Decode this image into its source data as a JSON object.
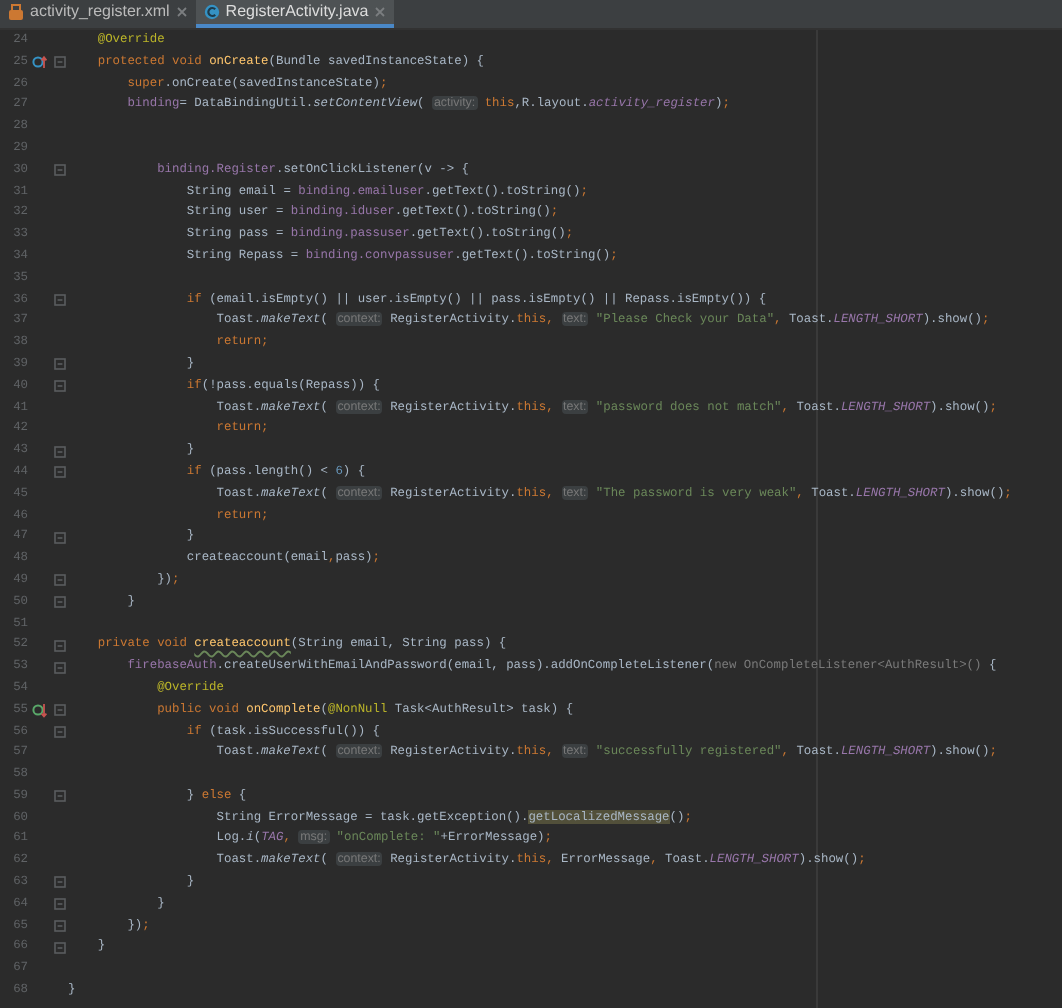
{
  "tabs": [
    {
      "label": "activity_register.xml",
      "kind": "xml",
      "selected": false
    },
    {
      "label": "RegisterActivity.java",
      "kind": "java",
      "selected": true
    }
  ],
  "lines": [
    {
      "number": "24",
      "fold": false,
      "kind": "plain",
      "segments": [
        {
          "text": "    @Override",
          "kind": "annotation"
        }
      ]
    },
    {
      "number": "25",
      "fold": true,
      "kind": "override",
      "segments": [
        {
          "text": "    protected void ",
          "kind": "keyword"
        },
        {
          "text": "onCreate",
          "kind": "declaration"
        },
        {
          "text": "(Bundle savedInstanceState) {",
          "kind": "plain"
        }
      ]
    },
    {
      "number": "26",
      "fold": false,
      "kind": "plain",
      "segments": [
        {
          "text": "        super",
          "kind": "keyword"
        },
        {
          "text": ".onCreate(savedInstanceState)",
          "kind": "plain"
        },
        {
          "text": ";",
          "kind": "keyword"
        }
      ]
    },
    {
      "number": "27",
      "fold": false,
      "kind": "plain",
      "segments": [
        {
          "text": "        binding",
          "kind": "field"
        },
        {
          "text": "= DataBindingUtil.",
          "kind": "plain"
        },
        {
          "text": "setContentView",
          "kind": "static-method"
        },
        {
          "text": "( ",
          "kind": "plain"
        },
        {
          "text": "activity:",
          "kind": "hint"
        },
        {
          "text": " this",
          "kind": "keyword"
        },
        {
          "text": ",R.layout.",
          "kind": "plain"
        },
        {
          "text": "activity_register",
          "kind": "constant"
        },
        {
          "text": ")",
          "kind": "plain"
        },
        {
          "text": ";",
          "kind": "keyword"
        }
      ]
    },
    {
      "number": "28",
      "fold": false,
      "kind": "plain"
    },
    {
      "number": "29",
      "fold": false,
      "kind": "plain"
    },
    {
      "number": "30",
      "fold": true,
      "kind": "plain",
      "segments": [
        {
          "text": "            binding.Register",
          "kind": "field"
        },
        {
          "text": ".setOnClickListener(v -> {",
          "kind": "plain"
        }
      ]
    },
    {
      "number": "31",
      "fold": false,
      "kind": "plain",
      "segments": [
        {
          "text": "                String email = ",
          "kind": "plain"
        },
        {
          "text": "binding.emailuser",
          "kind": "field"
        },
        {
          "text": ".getText().toString()",
          "kind": "plain"
        },
        {
          "text": ";",
          "kind": "keyword"
        }
      ]
    },
    {
      "number": "32",
      "fold": false,
      "kind": "plain",
      "segments": [
        {
          "text": "                String user = ",
          "kind": "plain"
        },
        {
          "text": "binding.iduser",
          "kind": "field"
        },
        {
          "text": ".getText().toString()",
          "kind": "plain"
        },
        {
          "text": ";",
          "kind": "keyword"
        }
      ]
    },
    {
      "number": "33",
      "fold": false,
      "kind": "plain",
      "segments": [
        {
          "text": "                String pass = ",
          "kind": "plain"
        },
        {
          "text": "binding.passuser",
          "kind": "field"
        },
        {
          "text": ".getText().toString()",
          "kind": "plain"
        },
        {
          "text": ";",
          "kind": "keyword"
        }
      ]
    },
    {
      "number": "34",
      "fold": false,
      "kind": "plain",
      "segments": [
        {
          "text": "                String Repass = ",
          "kind": "plain"
        },
        {
          "text": "binding.convpassuser",
          "kind": "field"
        },
        {
          "text": ".getText().toString()",
          "kind": "plain"
        },
        {
          "text": ";",
          "kind": "keyword"
        }
      ]
    },
    {
      "number": "35",
      "fold": false,
      "kind": "plain"
    },
    {
      "number": "36",
      "fold": true,
      "kind": "plain",
      "segments": [
        {
          "text": "                if",
          "kind": "keyword"
        },
        {
          "text": " (email.isEmpty() || user.isEmpty() || pass.isEmpty() || Repass.isEmpty()) {",
          "kind": "plain"
        }
      ]
    },
    {
      "number": "37",
      "fold": false,
      "kind": "plain",
      "segments": [
        {
          "text": "                    Toast.",
          "kind": "plain"
        },
        {
          "text": "makeText",
          "kind": "static-method"
        },
        {
          "text": "( ",
          "kind": "plain"
        },
        {
          "text": "context:",
          "kind": "hint"
        },
        {
          "text": " RegisterActivity.",
          "kind": "plain"
        },
        {
          "text": "this, ",
          "kind": "keyword"
        },
        {
          "text": "text:",
          "kind": "hint"
        },
        {
          "text": " \"Please Check your Data\"",
          "kind": "string"
        },
        {
          "text": ", ",
          "kind": "keyword"
        },
        {
          "text": "Toast.",
          "kind": "plain"
        },
        {
          "text": "LENGTH_SHORT",
          "kind": "constant"
        },
        {
          "text": ").show()",
          "kind": "plain"
        },
        {
          "text": ";",
          "kind": "keyword"
        }
      ]
    },
    {
      "number": "38",
      "fold": false,
      "kind": "plain",
      "segments": [
        {
          "text": "                    return;",
          "kind": "keyword"
        }
      ]
    },
    {
      "number": "39",
      "fold": true,
      "kind": "plain",
      "segments": [
        {
          "text": "                }",
          "kind": "plain"
        }
      ]
    },
    {
      "number": "40",
      "fold": true,
      "kind": "plain",
      "segments": [
        {
          "text": "                if",
          "kind": "keyword"
        },
        {
          "text": "(!pass.equals(Repass)) {",
          "kind": "plain"
        }
      ]
    },
    {
      "number": "41",
      "fold": false,
      "kind": "plain",
      "segments": [
        {
          "text": "                    Toast.",
          "kind": "plain"
        },
        {
          "text": "makeText",
          "kind": "static-method"
        },
        {
          "text": "( ",
          "kind": "plain"
        },
        {
          "text": "context:",
          "kind": "hint"
        },
        {
          "text": " RegisterActivity.",
          "kind": "plain"
        },
        {
          "text": "this, ",
          "kind": "keyword"
        },
        {
          "text": "text:",
          "kind": "hint"
        },
        {
          "text": " \"password does not match\"",
          "kind": "string"
        },
        {
          "text": ", ",
          "kind": "keyword"
        },
        {
          "text": "Toast.",
          "kind": "plain"
        },
        {
          "text": "LENGTH_SHORT",
          "kind": "constant"
        },
        {
          "text": ").show()",
          "kind": "plain"
        },
        {
          "text": ";",
          "kind": "keyword"
        }
      ]
    },
    {
      "number": "42",
      "fold": false,
      "kind": "plain",
      "segments": [
        {
          "text": "                    return;",
          "kind": "keyword"
        }
      ]
    },
    {
      "number": "43",
      "fold": true,
      "kind": "plain",
      "segments": [
        {
          "text": "                }",
          "kind": "plain"
        }
      ]
    },
    {
      "number": "44",
      "fold": true,
      "kind": "plain",
      "segments": [
        {
          "text": "                if",
          "kind": "keyword"
        },
        {
          "text": " (pass.length() < ",
          "kind": "plain"
        },
        {
          "text": "6",
          "kind": "number"
        },
        {
          "text": ") {",
          "kind": "plain"
        }
      ]
    },
    {
      "number": "45",
      "fold": false,
      "kind": "plain",
      "segments": [
        {
          "text": "                    Toast.",
          "kind": "plain"
        },
        {
          "text": "makeText",
          "kind": "static-method"
        },
        {
          "text": "( ",
          "kind": "plain"
        },
        {
          "text": "context:",
          "kind": "hint"
        },
        {
          "text": " RegisterActivity.",
          "kind": "plain"
        },
        {
          "text": "this, ",
          "kind": "keyword"
        },
        {
          "text": "text:",
          "kind": "hint"
        },
        {
          "text": " \"The password is very weak\"",
          "kind": "string"
        },
        {
          "text": ", ",
          "kind": "keyword"
        },
        {
          "text": "Toast.",
          "kind": "plain"
        },
        {
          "text": "LENGTH_SHORT",
          "kind": "constant"
        },
        {
          "text": ").show()",
          "kind": "plain"
        },
        {
          "text": ";",
          "kind": "keyword"
        }
      ]
    },
    {
      "number": "46",
      "fold": false,
      "kind": "plain",
      "segments": [
        {
          "text": "                    return;",
          "kind": "keyword"
        }
      ]
    },
    {
      "number": "47",
      "fold": true,
      "kind": "plain",
      "segments": [
        {
          "text": "                }",
          "kind": "plain"
        }
      ]
    },
    {
      "number": "48",
      "fold": false,
      "kind": "plain",
      "segments": [
        {
          "text": "                createaccount(email",
          "kind": "plain"
        },
        {
          "text": ",",
          "kind": "keyword"
        },
        {
          "text": "pass)",
          "kind": "plain"
        },
        {
          "text": ";",
          "kind": "keyword"
        }
      ]
    },
    {
      "number": "49",
      "fold": true,
      "kind": "plain",
      "segments": [
        {
          "text": "            })",
          "kind": "plain"
        },
        {
          "text": ";",
          "kind": "keyword"
        }
      ]
    },
    {
      "number": "50",
      "fold": true,
      "kind": "plain",
      "segments": [
        {
          "text": "        }",
          "kind": "plain"
        }
      ]
    },
    {
      "number": "51",
      "fold": false,
      "kind": "plain"
    },
    {
      "number": "52",
      "fold": true,
      "kind": "plain",
      "segments": [
        {
          "text": "    private void ",
          "kind": "keyword"
        },
        {
          "text": "createaccount",
          "kind": "declaration-unused"
        },
        {
          "text": "(String email, String pass) {",
          "kind": "plain"
        }
      ]
    },
    {
      "number": "53",
      "fold": true,
      "kind": "plain",
      "segments": [
        {
          "text": "        firebaseAuth",
          "kind": "field"
        },
        {
          "text": ".createUserWithEmailAndPassword(email, pass).addOnCompleteListener(",
          "kind": "plain"
        },
        {
          "text": "new OnCompleteListener<AuthResult>()",
          "kind": "folded"
        },
        {
          "text": " {",
          "kind": "plain"
        }
      ]
    },
    {
      "number": "54",
      "fold": false,
      "kind": "plain",
      "segments": [
        {
          "text": "            @Override",
          "kind": "annotation"
        }
      ]
    },
    {
      "number": "55",
      "fold": true,
      "kind": "implement",
      "segments": [
        {
          "text": "            public void ",
          "kind": "keyword"
        },
        {
          "text": "onComplete",
          "kind": "declaration"
        },
        {
          "text": "(",
          "kind": "plain"
        },
        {
          "text": "@NonNull",
          "kind": "annotation"
        },
        {
          "text": " Task<AuthResult> task) {",
          "kind": "plain"
        }
      ]
    },
    {
      "number": "56",
      "fold": true,
      "kind": "plain",
      "segments": [
        {
          "text": "                if",
          "kind": "keyword"
        },
        {
          "text": " (task.isSuccessful()) {",
          "kind": "plain"
        }
      ]
    },
    {
      "number": "57",
      "fold": false,
      "kind": "plain",
      "segments": [
        {
          "text": "                    Toast.",
          "kind": "plain"
        },
        {
          "text": "makeText",
          "kind": "static-method"
        },
        {
          "text": "( ",
          "kind": "plain"
        },
        {
          "text": "context:",
          "kind": "hint"
        },
        {
          "text": " RegisterActivity.",
          "kind": "plain"
        },
        {
          "text": "this, ",
          "kind": "keyword"
        },
        {
          "text": "text:",
          "kind": "hint"
        },
        {
          "text": " \"successfully registered\"",
          "kind": "string"
        },
        {
          "text": ", ",
          "kind": "keyword"
        },
        {
          "text": "Toast.",
          "kind": "plain"
        },
        {
          "text": "LENGTH_SHORT",
          "kind": "constant"
        },
        {
          "text": ").show()",
          "kind": "plain"
        },
        {
          "text": ";",
          "kind": "keyword"
        }
      ]
    },
    {
      "number": "58",
      "fold": false,
      "kind": "plain"
    },
    {
      "number": "59",
      "fold": true,
      "kind": "plain",
      "segments": [
        {
          "text": "                } ",
          "kind": "plain"
        },
        {
          "text": "else",
          "kind": "keyword"
        },
        {
          "text": " {",
          "kind": "plain"
        }
      ]
    },
    {
      "number": "60",
      "fold": false,
      "kind": "plain",
      "segments": [
        {
          "text": "                    String ErrorMessage = task.getException().",
          "kind": "plain"
        },
        {
          "text": "getLocalizedMessage",
          "kind": "highlight"
        },
        {
          "text": "()",
          "kind": "plain"
        },
        {
          "text": ";",
          "kind": "keyword"
        }
      ]
    },
    {
      "number": "61",
      "fold": false,
      "kind": "plain",
      "segments": [
        {
          "text": "                    Log.",
          "kind": "plain"
        },
        {
          "text": "i",
          "kind": "static-method"
        },
        {
          "text": "(",
          "kind": "plain"
        },
        {
          "text": "TAG",
          "kind": "constant"
        },
        {
          "text": ", ",
          "kind": "keyword"
        },
        {
          "text": "msg:",
          "kind": "hint"
        },
        {
          "text": " \"onComplete: \"",
          "kind": "string"
        },
        {
          "text": "+ErrorMessage)",
          "kind": "plain"
        },
        {
          "text": ";",
          "kind": "keyword"
        }
      ]
    },
    {
      "number": "62",
      "fold": false,
      "kind": "plain",
      "segments": [
        {
          "text": "                    Toast.",
          "kind": "plain"
        },
        {
          "text": "makeText",
          "kind": "static-method"
        },
        {
          "text": "( ",
          "kind": "plain"
        },
        {
          "text": "context:",
          "kind": "hint"
        },
        {
          "text": " RegisterActivity.",
          "kind": "plain"
        },
        {
          "text": "this",
          "kind": "keyword"
        },
        {
          "text": ", ",
          "kind": "keyword"
        },
        {
          "text": "ErrorMessage",
          "kind": "plain"
        },
        {
          "text": ", ",
          "kind": "keyword"
        },
        {
          "text": "Toast.",
          "kind": "plain"
        },
        {
          "text": "LENGTH_SHORT",
          "kind": "constant"
        },
        {
          "text": ").show()",
          "kind": "plain"
        },
        {
          "text": ";",
          "kind": "keyword"
        }
      ]
    },
    {
      "number": "63",
      "fold": true,
      "kind": "plain",
      "segments": [
        {
          "text": "                }",
          "kind": "plain"
        }
      ]
    },
    {
      "number": "64",
      "fold": true,
      "kind": "plain",
      "segments": [
        {
          "text": "            }",
          "kind": "plain"
        }
      ]
    },
    {
      "number": "65",
      "fold": true,
      "kind": "plain",
      "segments": [
        {
          "text": "        })",
          "kind": "plain"
        },
        {
          "text": ";",
          "kind": "keyword"
        }
      ]
    },
    {
      "number": "66",
      "fold": true,
      "kind": "plain",
      "segments": [
        {
          "text": "    }",
          "kind": "plain"
        }
      ]
    },
    {
      "number": "67",
      "fold": false,
      "kind": "plain"
    },
    {
      "number": "68",
      "fold": false,
      "kind": "plain",
      "segments": [
        {
          "text": "}",
          "kind": "plain"
        }
      ]
    }
  ]
}
